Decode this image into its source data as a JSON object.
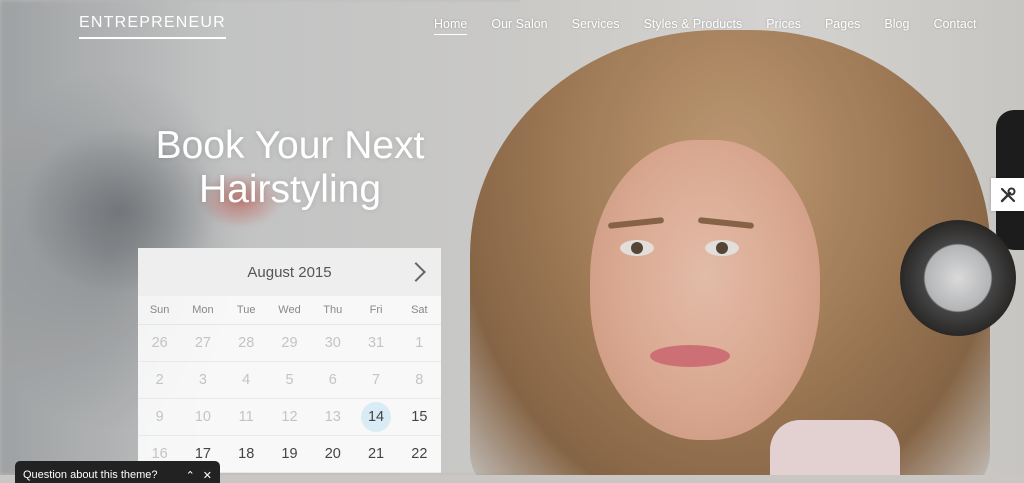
{
  "site": {
    "logo": "ENTREPRENEUR"
  },
  "nav": {
    "items": [
      {
        "label": "Home",
        "active": true
      },
      {
        "label": "Our Salon"
      },
      {
        "label": "Services"
      },
      {
        "label": "Styles & Products"
      },
      {
        "label": "Prices"
      },
      {
        "label": "Pages"
      },
      {
        "label": "Blog"
      },
      {
        "label": "Contact"
      }
    ]
  },
  "hero": {
    "headline_line1": "Book Your Next",
    "headline_line2": "Hairstyling"
  },
  "calendar": {
    "month_label": "August 2015",
    "weekdays": [
      "Sun",
      "Mon",
      "Tue",
      "Wed",
      "Thu",
      "Fri",
      "Sat"
    ],
    "weeks": [
      [
        "26",
        "27",
        "28",
        "29",
        "30",
        "31",
        "1"
      ],
      [
        "2",
        "3",
        "4",
        "5",
        "6",
        "7",
        "8"
      ],
      [
        "9",
        "10",
        "11",
        "12",
        "13",
        "14",
        "15"
      ],
      [
        "16",
        "17",
        "18",
        "19",
        "20",
        "21",
        "22"
      ]
    ],
    "today": "14"
  },
  "question_bar": {
    "text": "Question about this theme?",
    "collapse_icon": "chevron-up-icon",
    "close_icon": "close-icon"
  },
  "side_tool": {
    "icon": "tools-icon"
  }
}
